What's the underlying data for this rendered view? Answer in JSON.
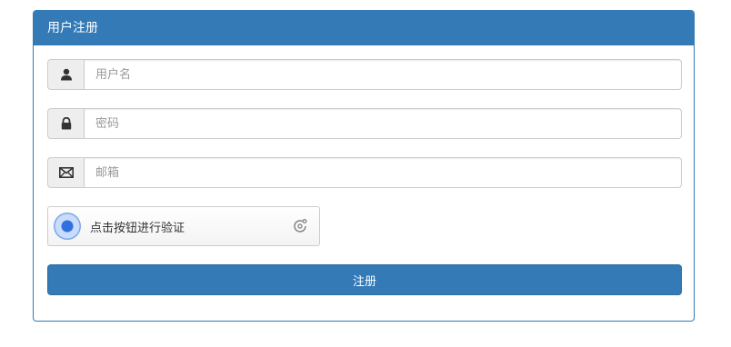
{
  "panel": {
    "title": "用户注册"
  },
  "form": {
    "username": {
      "icon": "user-icon",
      "placeholder": "用户名",
      "value": ""
    },
    "password": {
      "icon": "lock-icon",
      "placeholder": "密码",
      "value": ""
    },
    "email": {
      "icon": "envelope-icon",
      "placeholder": "邮箱",
      "value": ""
    },
    "captcha": {
      "label": "点击按钮进行验证",
      "icon": "captcha-circle-icon",
      "refresh_icon": "refresh-icon"
    },
    "submit_label": "注册"
  },
  "colors": {
    "primary": "#337ab7",
    "addon_bg": "#eeeeee",
    "border": "#cccccc",
    "captcha_accent": "#2f6fe0"
  }
}
